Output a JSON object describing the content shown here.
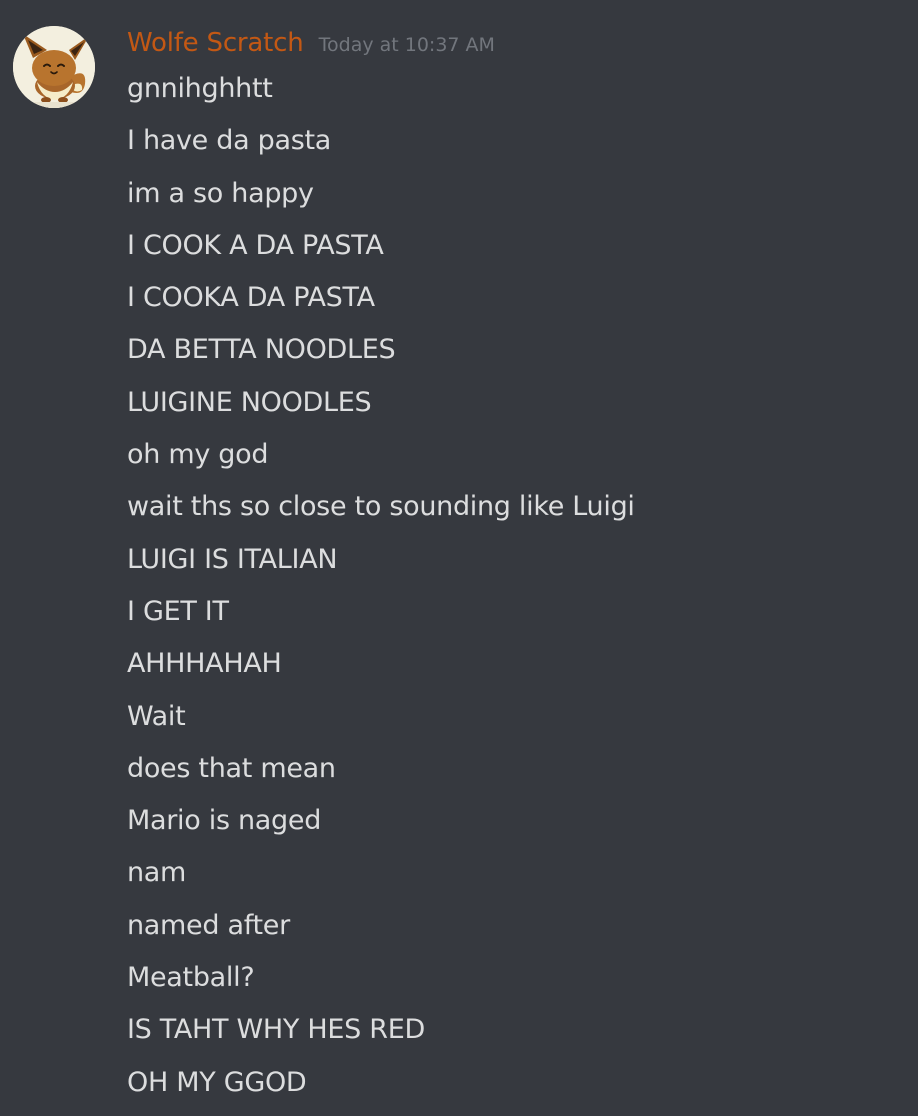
{
  "message": {
    "author": "Wolfe Scratch",
    "timestamp": "Today at 10:37 AM",
    "author_color": "#c35814",
    "avatar_icon": "eevee-avatar",
    "lines": [
      "gnnihghhtt",
      "I have da pasta",
      "im a so happy",
      "I COOK A DA PASTA",
      "I COOKA DA PASTA",
      "DA BETTA NOODLES",
      "LUIGINE NOODLES",
      "oh my god",
      "wait ths so close to sounding like Luigi",
      "LUIGI IS ITALIAN",
      "I GET IT",
      "AHHHAHAH",
      "Wait",
      "does that mean",
      "Mario is naged",
      "nam",
      "named after",
      "Meatball?",
      "IS TAHT WHY HES RED",
      "OH MY GGOD"
    ]
  },
  "colors": {
    "background": "#36393f",
    "text": "#dcddde",
    "timestamp": "#72767d"
  }
}
